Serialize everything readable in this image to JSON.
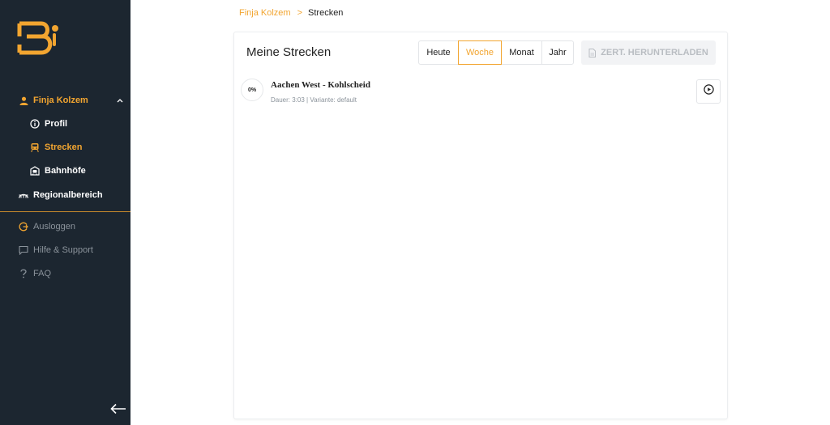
{
  "sidebar": {
    "user": {
      "label": "Finja Kolzem",
      "icon": "user-icon"
    },
    "subitems": [
      {
        "label": "Profil",
        "icon": "info-circle-icon"
      },
      {
        "label": "Strecken",
        "icon": "train-icon"
      },
      {
        "label": "Bahnhöfe",
        "icon": "station-icon"
      }
    ],
    "region": {
      "label": "Regionalbereich",
      "icon": "bridge-icon"
    },
    "bottom": [
      {
        "label": "Ausloggen",
        "icon": "logout-icon"
      },
      {
        "label": "Hilfe & Support",
        "icon": "chat-icon"
      },
      {
        "label": "FAQ",
        "icon": "question-icon"
      }
    ]
  },
  "breadcrumb": {
    "parent": "Finja Kolzem",
    "separator": ">",
    "current": "Strecken"
  },
  "main": {
    "title": "Meine Strecken",
    "periods": [
      "Heute",
      "Woche",
      "Monat",
      "Jahr"
    ],
    "active_period": "Woche",
    "download_label": "ZERT. HERUNTERLADEN",
    "routes": [
      {
        "progress": "0%",
        "name": "Aachen West - Kohlscheid",
        "meta": "Dauer: 3:03 | Variante: default"
      }
    ]
  },
  "colors": {
    "accent": "#f2a530",
    "sidebar_bg": "#1c2630",
    "muted": "#8b939b"
  }
}
